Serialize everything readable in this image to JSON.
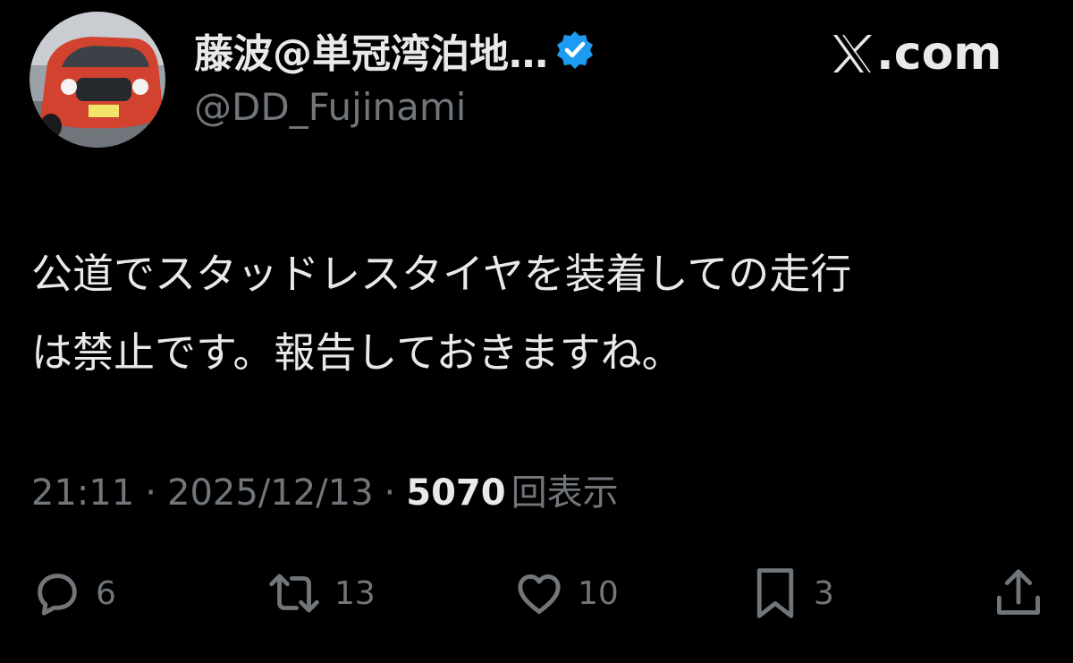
{
  "author": {
    "display_name": "藤波@単冠湾泊地…",
    "handle": "@DD_Fujinami",
    "verified": true,
    "avatar_icon": "red-car-photo-avatar"
  },
  "brand": {
    "logo_icon": "x-logo-icon",
    "label": ".com"
  },
  "tweet": {
    "lines": [
      "公道でスタッドレスタイヤを装着しての走行",
      "は禁止です。報告しておきますね。"
    ]
  },
  "meta": {
    "time": "21:11",
    "separator": "·",
    "date": "2025/12/13",
    "views_count": "5070",
    "views_label": "回表示"
  },
  "actions": {
    "replies": "6",
    "retweets": "13",
    "likes": "10",
    "bookmarks": "3"
  },
  "colors": {
    "background": "#000000",
    "text": "#e7e9ea",
    "muted": "#71767b",
    "verified_badge": "#1d9bf0"
  }
}
